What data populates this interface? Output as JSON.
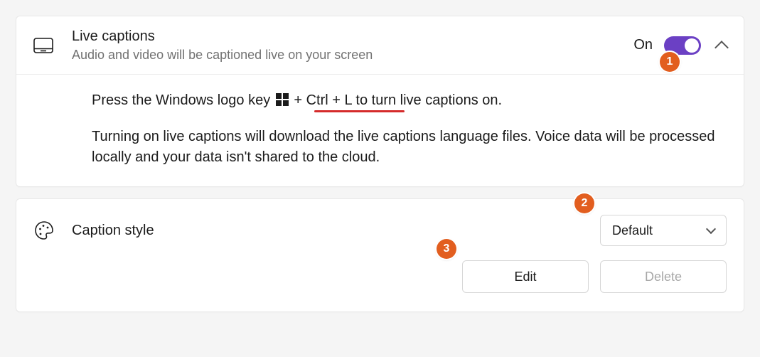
{
  "live_captions": {
    "title": "Live captions",
    "subtitle": "Audio and video will be captioned live on your screen",
    "state_label": "On",
    "toggle_on": true,
    "shortcut_prefix": "Press the Windows logo key ",
    "shortcut_keys": " + Ctrl + L",
    "shortcut_suffix": " to turn live captions on.",
    "download_note": "Turning on live captions will download the live captions language files. Voice data will be processed locally and your data isn't shared to the cloud."
  },
  "caption_style": {
    "label": "Caption style",
    "selected": "Default",
    "edit_label": "Edit",
    "delete_label": "Delete"
  },
  "annotations": {
    "b1": "1",
    "b2": "2",
    "b3": "3"
  },
  "colors": {
    "accent": "#6b40c4",
    "badge": "#e25e1f",
    "underline": "#d52b2b"
  }
}
